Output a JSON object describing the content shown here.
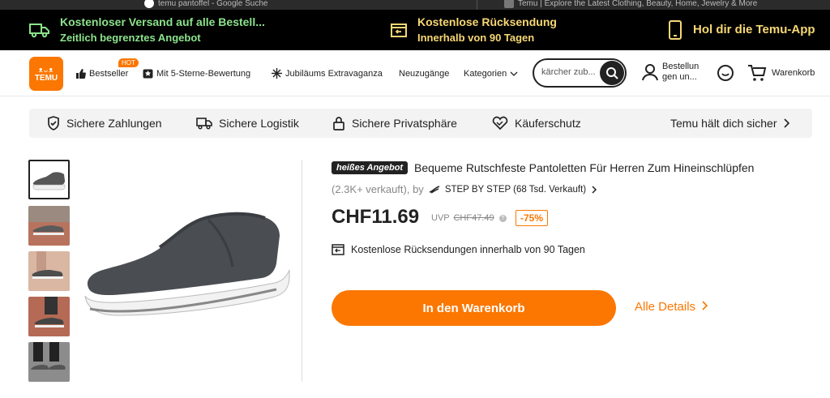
{
  "browser": {
    "tab1_title": "temu pantoffel - Google Suche",
    "tab2_title": "Temu | Explore the Latest Clothing, Beauty, Home, Jewelry & More"
  },
  "promo": {
    "shipping_line1": "Kostenloser Versand auf alle Bestell...",
    "shipping_line2": "Zeitlich begrenztes Angebot",
    "returns_line1": "Kostenlose Rücksendung",
    "returns_line2": "Innerhalb von 90 Tagen",
    "app_label": "Hol dir die Temu-App"
  },
  "header": {
    "logo_symbols": "ᴥᴗᴥ",
    "logo_text": "TEMU",
    "nav": {
      "bestseller": "Bestseller",
      "hot_badge": "HOT",
      "five_star": "Mit 5-Sterne-Bewertung",
      "anniversary": "Jubiläums Extravaganza",
      "new_arrivals": "Neuzugänge",
      "categories": "Kategorien"
    },
    "search_placeholder": "kärcher zub...",
    "orders_label": "Bestellungen un...",
    "orders_line1": "Bestellun",
    "orders_line2": "gen un...",
    "cart_label": "Warenkorb"
  },
  "trust": {
    "payments": "Sichere Zahlungen",
    "logistics": "Sichere Logistik",
    "privacy": "Sichere Privatsphäre",
    "buyer_protection": "Käuferschutz",
    "safe": "Temu hält dich sicher"
  },
  "product": {
    "badge": "heißes Angebot",
    "title": "Bequeme Rutschfeste Pantoletten Für Herren Zum Hineinschlüpfen",
    "sold": "(2.3K+ verkauft), by",
    "store": "STEP BY STEP (68 Tsd. Verkauft)",
    "price": "CHF11.69",
    "uvp_label": "UVP",
    "uvp_price": "CHF47.49",
    "discount": "-75%",
    "returns": "Kostenlose Rücksendungen innerhalb von 90 Tagen",
    "add_to_cart": "In den Warenkorb",
    "all_details": "Alle Details"
  },
  "colors": {
    "brand_orange": "#fb7701",
    "promo_green": "#8be38b",
    "promo_yellow": "#f7d774"
  }
}
